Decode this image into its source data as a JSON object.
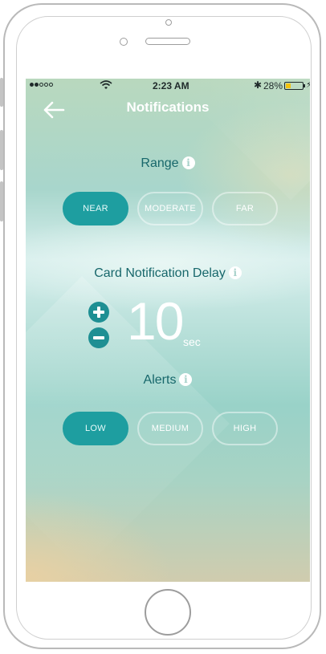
{
  "status_bar": {
    "carrier_dots": [
      "filled",
      "filled",
      "empty",
      "empty",
      "empty"
    ],
    "time": "2:23 AM",
    "bluetooth": "✱",
    "battery_percent": "28%",
    "battery_level": 0.28,
    "battery_color": "#f3c20f"
  },
  "header": {
    "title": "Notifications"
  },
  "range": {
    "label": "Range",
    "options": [
      {
        "label": "NEAR",
        "selected": true
      },
      {
        "label": "MODERATE",
        "selected": false
      },
      {
        "label": "FAR",
        "selected": false
      }
    ]
  },
  "delay": {
    "label": "Card Notification Delay",
    "value": "10",
    "unit": "sec"
  },
  "alerts": {
    "label": "Alerts",
    "options": [
      {
        "label": "LOW",
        "selected": true
      },
      {
        "label": "MEDIUM",
        "selected": false
      },
      {
        "label": "HIGH",
        "selected": false
      }
    ]
  },
  "colors": {
    "accent": "#1e9ea0",
    "label_text": "#17676b"
  },
  "icons": {
    "back": "arrow-left-icon",
    "info": "info-icon",
    "increment": "plus-circle-icon",
    "decrement": "minus-circle-icon"
  }
}
